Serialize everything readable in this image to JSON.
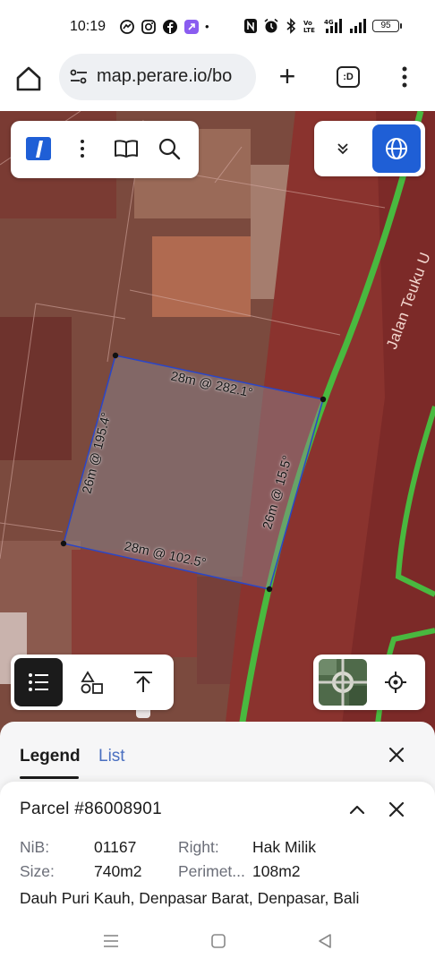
{
  "status_bar": {
    "time": "10:19",
    "battery": "95",
    "left_icons": [
      "messenger-icon",
      "instagram-icon",
      "facebook-icon",
      "app-icon",
      "dot"
    ],
    "right_icons": [
      "nfc-icon",
      "alarm-icon",
      "bluetooth-icon",
      "volte-icon",
      "4g-signal-icon",
      "signal-icon",
      "battery-icon"
    ]
  },
  "browser": {
    "url": "map.perare.io/bo",
    "tabs_label": ":D"
  },
  "map": {
    "road_name": "Jalan Teuku U",
    "dimensions": {
      "top": "28m @ 282.1°",
      "right": "26m @ 15.5°",
      "bottom": "28m @ 102.5°",
      "left": "26m @ 195.4°"
    }
  },
  "legend": {
    "tab_legend": "Legend",
    "tab_list": "List"
  },
  "parcel": {
    "title": "Parcel #86008901",
    "nib_label": "NiB:",
    "nib_value": "01167",
    "right_label": "Right:",
    "right_value": "Hak Milik",
    "size_label": "Size:",
    "size_value": "740m2",
    "perimeter_label": "Perimet...",
    "perimeter_value": "108m2",
    "address": "Dauh Puri Kauh, Denpasar Barat, Denpasar, Bali"
  },
  "colors": {
    "accent_blue": "#1f5fd6",
    "parcel_outline": "#2a46c8",
    "road_green": "#45b33c",
    "list_tab": "#4a6fc0"
  }
}
